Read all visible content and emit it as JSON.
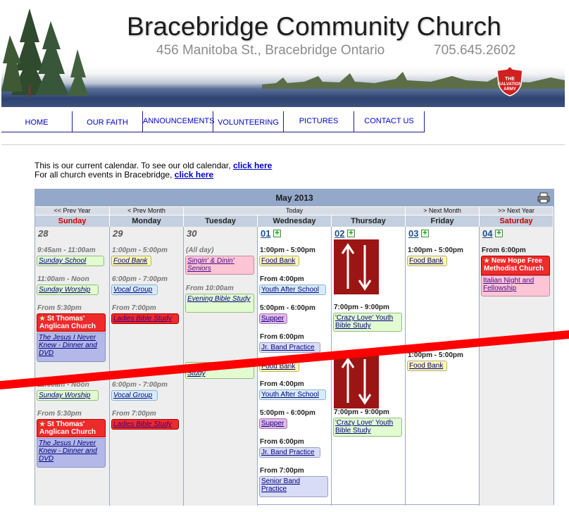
{
  "banner": {
    "title": "Bracebridge Community Church",
    "address": "456 Manitoba St., Bracebridge Ontario",
    "phone": "705.645.2602",
    "logo_icon": "salvation-army-shield-icon"
  },
  "nav": {
    "home": "HOME",
    "faith": "OUR FAITH",
    "announcements": "ANNOUNCEMENTS",
    "volunteering": "VOLUNTEERING",
    "pictures": "PICTURES",
    "contact": "CONTACT US"
  },
  "intro": {
    "line1": "This is our current calendar. To see our old calendar, ",
    "link1": "click here",
    "line2": "For all church events in Bracebridge, ",
    "link2": "click here"
  },
  "calendar": {
    "title": "May 2013",
    "controls": {
      "prev_year": "<< Prev Year",
      "prev_month": "< Prev Month",
      "today": "Today",
      "next_month": "> Next Month",
      "next_year": ">> Next Year"
    },
    "days": [
      "Sunday",
      "Monday",
      "Tuesday",
      "Wednesday",
      "Thursday",
      "Friday",
      "Saturday"
    ],
    "dates": [
      "28",
      "29",
      "30",
      "01",
      "02",
      "03",
      "04"
    ],
    "add_symbol": "+",
    "sunday": {
      "t1": "9:45am - 11:00am",
      "e1": "Sunday School",
      "t2": "11:00am - Noon",
      "e2": "Sunday Worship",
      "t3": "From 5:30pm",
      "h3": "St Thomas' Anglican Church",
      "e3": "The Jesus I Never Knew - Dinner and DVD",
      "t4": "11:00am - Noon",
      "e4": "Sunday Worship",
      "t5": "From 5:30pm",
      "h5": "St Thomas' Anglican Church",
      "e5": "The Jesus I Never Knew - Dinner and DVD"
    },
    "monday": {
      "t1": "1:00pm - 5:00pm",
      "e1": "Food Bank",
      "t2": "6:00pm - 7:00pm",
      "e2": "Vocal Group",
      "t3": "From 7:00pm",
      "e3": "Ladies Bible Study",
      "t4": "6:00pm - 7:00pm",
      "e4": "Vocal Group",
      "t5": "From 7:00pm",
      "e5": "Ladies Bible Study"
    },
    "tuesday": {
      "t1": "(All day)",
      "e1": "Singin' & Dinin' Seniors",
      "t2": "From 10:00am",
      "e2": "Evening Bible Study",
      "e3": "Study"
    },
    "wednesday": {
      "t1": "1:00pm - 5:00pm",
      "e1": "Food Bank",
      "t2": "From 4:00pm",
      "e2": "Youth After School",
      "t3": "5:00pm - 6:00pm",
      "e3": "Supper",
      "t4": "From 6:00pm",
      "e4": "Jr. Band Practice",
      "e5": "Food Bank",
      "t6": "From 4:00pm",
      "e6": "Youth After School",
      "t7": "5:00pm - 6:00pm",
      "e7": "Supper",
      "t8": "From 6:00pm",
      "e8": "Jr. Band Practice",
      "t9": "From 7:00pm",
      "e9": "Senior Band Practice"
    },
    "thursday": {
      "t1": "7:00pm - 9:00pm",
      "e1": "'Crazy Love' Youth Bible Study",
      "t2": "7:00pm - 9:00pm",
      "e2": "'Crazy Love' Youth Bible Study"
    },
    "friday": {
      "t1": "1:00pm - 5:00pm",
      "e1": "Food Bank",
      "t2": "1:00pm - 5:00pm",
      "e2": "Food Bank"
    },
    "saturday": {
      "t1": "From 6:00pm",
      "h1": "New Hope Free Methodist Church",
      "e1": "Italian Night and Fellowship"
    }
  },
  "colors": {
    "slash": "#ff0000",
    "title_bar": "#94a9c9",
    "weekend": "#cc0000",
    "arrows_tile": "#9c1515"
  }
}
